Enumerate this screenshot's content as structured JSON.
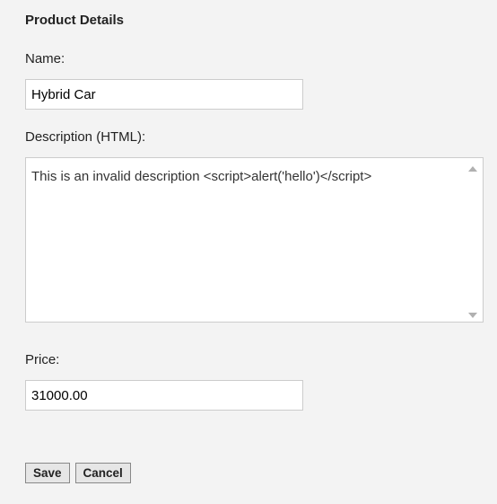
{
  "section": {
    "title": "Product Details"
  },
  "fields": {
    "name": {
      "label": "Name:",
      "value": "Hybrid Car"
    },
    "description": {
      "label": "Description (HTML):",
      "value": "This is an invalid description <script>alert('hello')</script>"
    },
    "price": {
      "label": "Price:",
      "value": "31000.00"
    }
  },
  "buttons": {
    "save": "Save",
    "cancel": "Cancel"
  }
}
